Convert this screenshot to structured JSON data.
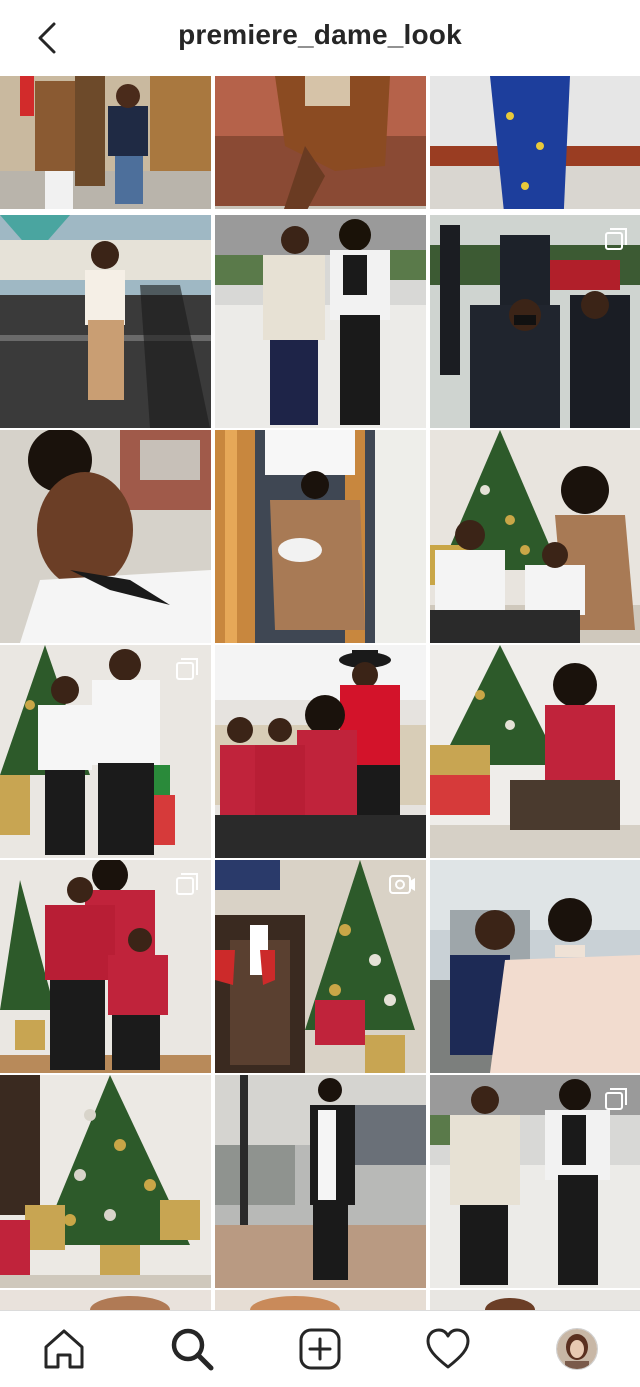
{
  "header": {
    "username": "premiere_dame_look",
    "back_icon": "chevron-left-icon"
  },
  "posts": [
    {
      "row": 0,
      "col": 0,
      "scene": "street-family-coats",
      "badge": "none"
    },
    {
      "row": 0,
      "col": 1,
      "scene": "brown-coat-wall-sitting",
      "badge": "none"
    },
    {
      "row": 0,
      "col": 2,
      "scene": "blue-dress-legs",
      "badge": "none"
    },
    {
      "row": 1,
      "col": 0,
      "scene": "beige-outfit-street-shadow",
      "badge": "none"
    },
    {
      "row": 1,
      "col": 1,
      "scene": "two-women-white-jackets",
      "badge": "none"
    },
    {
      "row": 1,
      "col": 2,
      "scene": "funeral-gathering",
      "badge": "carousel"
    },
    {
      "row": 2,
      "col": 0,
      "scene": "closeup-selfie-bow-blouse",
      "badge": "none"
    },
    {
      "row": 2,
      "col": 1,
      "scene": "gold-dress-staircase",
      "badge": "none"
    },
    {
      "row": 2,
      "col": 2,
      "scene": "christmas-tree-family-white",
      "badge": "none"
    },
    {
      "row": 3,
      "col": 0,
      "scene": "two-boys-white-shirts-tree",
      "badge": "carousel"
    },
    {
      "row": 3,
      "col": 1,
      "scene": "family-red-plaid-sofa",
      "badge": "none"
    },
    {
      "row": 3,
      "col": 2,
      "scene": "woman-plaid-shirt-presents",
      "badge": "none"
    },
    {
      "row": 4,
      "col": 0,
      "scene": "mother-sons-plaid-tree",
      "badge": "carousel"
    },
    {
      "row": 4,
      "col": 1,
      "scene": "fireplace-stockings-tree",
      "badge": "video"
    },
    {
      "row": 4,
      "col": 2,
      "scene": "woman-boy-pink-blouse",
      "badge": "none"
    },
    {
      "row": 5,
      "col": 0,
      "scene": "christmas-tree-gifts",
      "badge": "none"
    },
    {
      "row": 5,
      "col": 1,
      "scene": "woman-scarf-street",
      "badge": "none"
    },
    {
      "row": 5,
      "col": 2,
      "scene": "two-women-white-jackets-2",
      "badge": "carousel"
    }
  ],
  "tabbar": {
    "items": [
      {
        "name": "home-tab",
        "icon": "home-icon"
      },
      {
        "name": "search-tab",
        "icon": "search-icon",
        "active": true
      },
      {
        "name": "new-post-tab",
        "icon": "add-post-icon"
      },
      {
        "name": "activity-tab",
        "icon": "heart-icon"
      },
      {
        "name": "profile-tab",
        "icon": "profile-avatar"
      }
    ]
  },
  "colors": {
    "text": "#262626",
    "divider": "#dbdbdb",
    "plaid_red": "#c0233b",
    "tree_green": "#2d5a2a"
  }
}
